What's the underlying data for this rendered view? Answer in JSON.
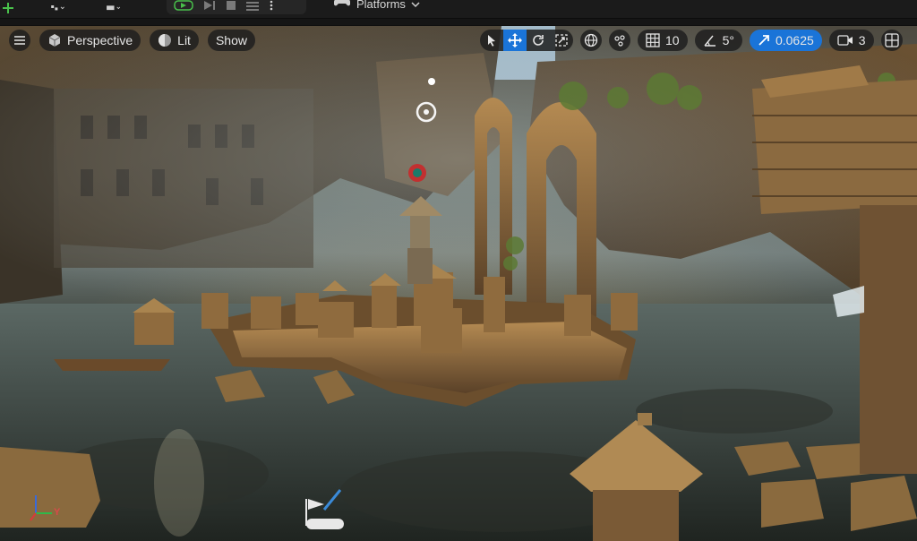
{
  "toolbar": {
    "platforms_label": "Platforms"
  },
  "viewport": {
    "view_mode": "Perspective",
    "lighting_mode": "Lit",
    "show_label": "Show",
    "grid_snap_value": "10",
    "rotation_snap_value": "5°",
    "scale_snap_value": "0.0625",
    "camera_speed_value": "3",
    "axis_y_label": "Y"
  },
  "colors": {
    "accent": "#1a74d8",
    "overlay_bg": "#1e1e1e",
    "toolbar_bg": "#1b1b1b"
  }
}
